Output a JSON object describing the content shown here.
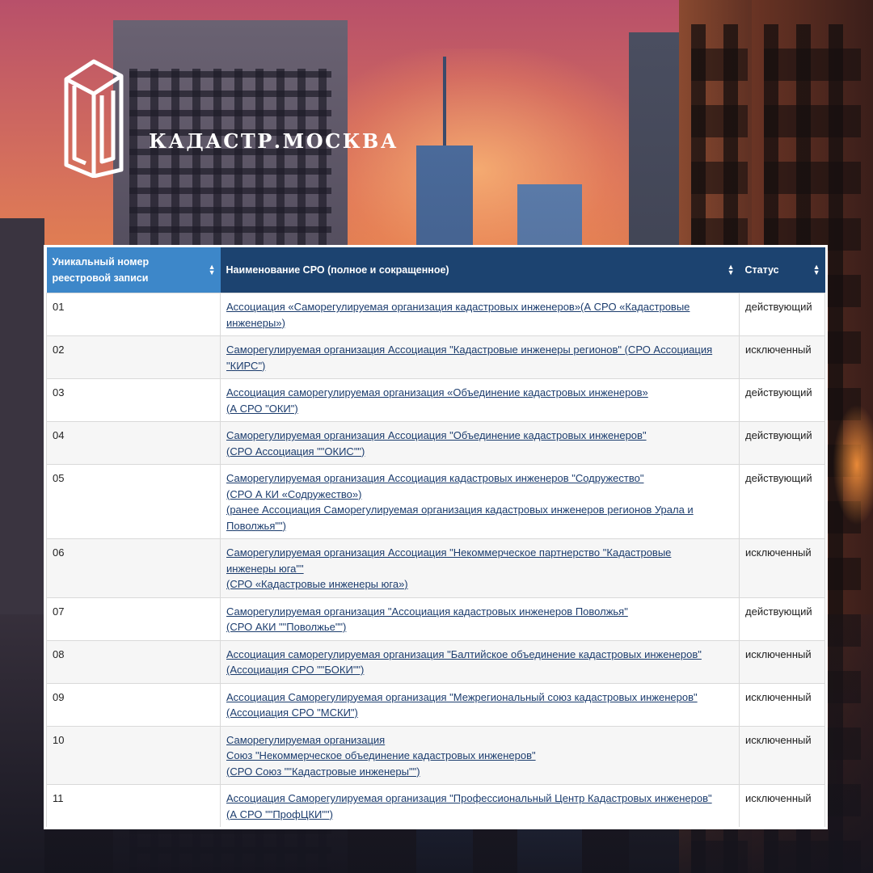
{
  "brand": {
    "name": "КАДАСТР.МОСКВА",
    "logo_icon": "glass-tower-logo-icon"
  },
  "table": {
    "headers": {
      "number": "Уникальный номер реестровой записи",
      "name": "Наименование СРО (полное и сокращенное)",
      "status": "Статус"
    },
    "rows": [
      {
        "num": "01",
        "name_lines": [
          "Ассоциация «Саморегулируемая организация кадастровых инженеров»(А СРО «Кадастровые",
          "инженеры»)"
        ],
        "status": "действующий"
      },
      {
        "num": "02",
        "name_lines": [
          "Саморегулируемая организация Ассоциация \"Кадастровые инженеры регионов\" (СРО Ассоциация",
          "\"КИРС\")"
        ],
        "status": "исключенный"
      },
      {
        "num": "03",
        "name_lines": [
          "Ассоциация саморегулируемая организация «Объединение кадастровых инженеров»",
          "(А СРО \"ОКИ\")"
        ],
        "status": "действующий"
      },
      {
        "num": "04",
        "name_lines": [
          "Саморегулируемая организация Ассоциация \"Объединение кадастровых инженеров\"",
          "(СРО Ассоциация \"\"ОКИС\"\")"
        ],
        "status": "действующий"
      },
      {
        "num": "05",
        "name_lines": [
          "Саморегулируемая организация Ассоциация кадастровых инженеров \"Содружество\"",
          "(СРО А КИ «Содружество»)",
          "(ранее Ассоциация Саморегулируемая организация кадастровых инженеров регионов Урала и",
          "Поволжья\"\")"
        ],
        "status": "действующий"
      },
      {
        "num": "06",
        "name_lines": [
          "Саморегулируемая организация Ассоциация \"Некоммерческое партнерство \"Кадастровые",
          "инженеры юга\"\"",
          "(СРО «Кадастровые инженеры юга»)"
        ],
        "status": "исключенный"
      },
      {
        "num": "07",
        "name_lines": [
          "Саморегулируемая организация \"Ассоциация кадастровых инженеров Поволжья\"",
          "(СРО АКИ \"\"Поволжье\"\")"
        ],
        "status": "действующий"
      },
      {
        "num": "08",
        "name_lines": [
          "Ассоциация саморегулируемая организация \"Балтийское объединение кадастровых инженеров\"",
          "(Ассоциация СРО \"\"БОКИ\"\")"
        ],
        "status": "исключенный"
      },
      {
        "num": "09",
        "name_lines": [
          "Ассоциация Саморегулируемая организация \"Межрегиональный союз кадастровых инженеров\"",
          "(Ассоциация СРО \"МСКИ\")"
        ],
        "status": "исключенный"
      },
      {
        "num": "10",
        "name_lines": [
          "Саморегулируемая организация",
          "Союз \"Некоммерческое объединение кадастровых инженеров\"",
          "(СРО Союз \"\"Кадастровые инженеры\"\")"
        ],
        "status": "исключенный"
      },
      {
        "num": "11",
        "name_lines": [
          "Ассоциация Саморегулируемая организация \"Профессиональный Центр Кадастровых инженеров\"",
          "(А СРО \"\"ПрофЦКИ\"\")"
        ],
        "status": "исключенный"
      },
      {
        "num": "",
        "name_lines": [
          ""
        ],
        "status": ""
      }
    ]
  }
}
